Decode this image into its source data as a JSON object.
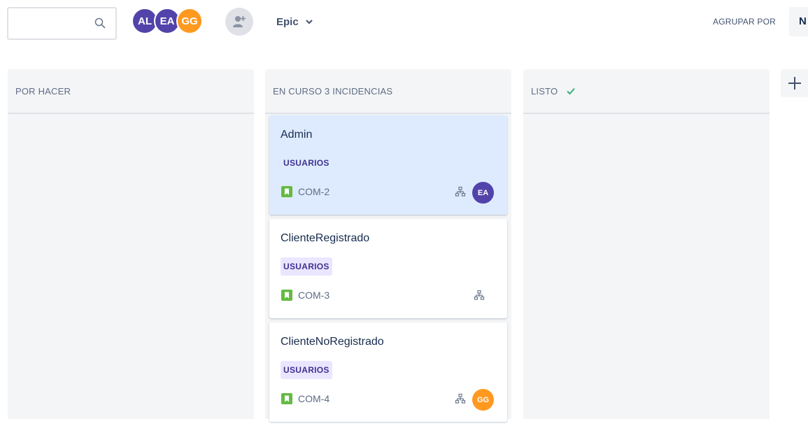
{
  "toolbar": {
    "search": {
      "value": "",
      "placeholder": ""
    },
    "avatars": [
      {
        "initials": "AL",
        "color": "#5243aa"
      },
      {
        "initials": "EA",
        "color": "#5243aa"
      },
      {
        "initials": "GG",
        "color": "#ff991f"
      }
    ],
    "epic_filter_label": "Epic",
    "group_by_label": "AGRUPAR POR",
    "group_by_value": "N"
  },
  "columns": [
    {
      "title": "POR HACER",
      "count_label": "",
      "done": false
    },
    {
      "title": "EN CURSO",
      "count_label": "3 INCIDENCIAS",
      "done": false
    },
    {
      "title": "LISTO",
      "count_label": "",
      "done": true
    }
  ],
  "cards": [
    {
      "summary": "Admin",
      "epic": "USUARIOS",
      "key": "COM-2",
      "type_icon": "story-icon",
      "has_subtasks": true,
      "assignee": "EA",
      "assignee_color": "#5243aa",
      "selected": true
    },
    {
      "summary": "ClienteRegistrado",
      "epic": "USUARIOS",
      "key": "COM-3",
      "type_icon": "story-icon",
      "has_subtasks": true,
      "assignee": "",
      "selected": false
    },
    {
      "summary": "ClienteNoRegistrado",
      "epic": "USUARIOS",
      "key": "COM-4",
      "type_icon": "story-icon",
      "has_subtasks": true,
      "assignee": "GG",
      "assignee_color": "#ff991f",
      "selected": false
    }
  ],
  "colors": {
    "accent": "#5243aa",
    "story": "#65ba43",
    "done": "#36b37e",
    "epic_bg": "#eae6ff",
    "epic_text": "#403294"
  }
}
